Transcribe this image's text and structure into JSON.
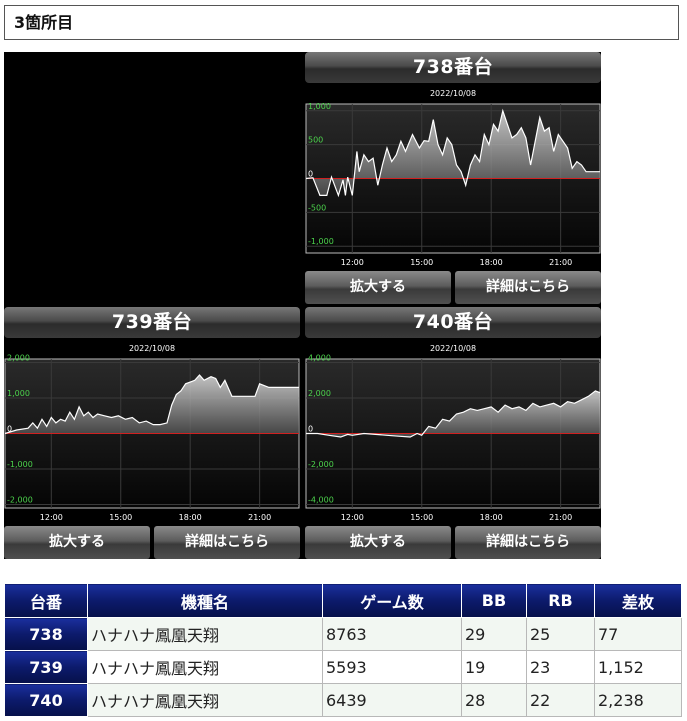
{
  "heading": "3箇所目",
  "machines": [
    {
      "title": "738番台",
      "date": "2022/10/08",
      "zoom_label": "拡大する",
      "detail_label": "詳細はこちら",
      "chart_data": {
        "type": "line",
        "y_ticks": [
          "1,000",
          "500",
          "0",
          "-500",
          "-1,000"
        ],
        "ylim": [
          -1100,
          1100
        ],
        "x_ticks": [
          "12:00",
          "15:00",
          "18:00",
          "21:00"
        ],
        "x_tick_hours": [
          12,
          15,
          18,
          21
        ],
        "xlim": [
          10.0,
          22.7
        ],
        "x": [
          10.0,
          10.3,
          10.6,
          10.9,
          11.1,
          11.4,
          11.6,
          11.7,
          11.8,
          12.0,
          12.2,
          12.3,
          12.5,
          12.7,
          12.9,
          13.1,
          13.3,
          13.5,
          13.7,
          13.9,
          14.1,
          14.3,
          14.6,
          14.9,
          15.1,
          15.3,
          15.5,
          15.7,
          15.9,
          16.1,
          16.3,
          16.5,
          16.7,
          16.9,
          17.1,
          17.3,
          17.5,
          17.7,
          17.9,
          18.1,
          18.3,
          18.5,
          18.7,
          18.9,
          19.1,
          19.3,
          19.5,
          19.7,
          19.9,
          20.1,
          20.3,
          20.5,
          20.7,
          20.9,
          21.1,
          21.3,
          21.5,
          21.7,
          21.9,
          22.1,
          22.3,
          22.7
        ],
        "values": [
          0,
          10,
          -250,
          -250,
          20,
          -250,
          -20,
          -250,
          20,
          -250,
          400,
          100,
          350,
          250,
          300,
          -100,
          200,
          450,
          250,
          350,
          550,
          400,
          650,
          450,
          560,
          550,
          870,
          500,
          350,
          600,
          500,
          200,
          100,
          -100,
          200,
          350,
          250,
          650,
          500,
          800,
          700,
          1000,
          800,
          600,
          650,
          750,
          600,
          200,
          550,
          900,
          700,
          750,
          400,
          650,
          550,
          450,
          150,
          250,
          200,
          100,
          100,
          100
        ],
        "zero_line": 0
      }
    },
    {
      "title": "739番台",
      "date": "2022/10/08",
      "zoom_label": "拡大する",
      "detail_label": "詳細はこちら",
      "chart_data": {
        "type": "line",
        "y_ticks": [
          "2,000",
          "1,000",
          "0",
          "-1,000",
          "-2,000"
        ],
        "ylim": [
          -2100,
          2100
        ],
        "x_ticks": [
          "12:00",
          "15:00",
          "18:00",
          "21:00"
        ],
        "x_tick_hours": [
          12,
          15,
          18,
          21
        ],
        "xlim": [
          10.0,
          22.7
        ],
        "x": [
          10.0,
          10.5,
          11.0,
          11.2,
          11.4,
          11.6,
          11.8,
          12.0,
          12.2,
          12.4,
          12.6,
          12.8,
          13.0,
          13.2,
          13.4,
          13.6,
          13.8,
          14.0,
          14.3,
          14.6,
          14.9,
          15.2,
          15.5,
          15.8,
          16.1,
          16.4,
          16.7,
          17.0,
          17.2,
          17.4,
          17.6,
          17.8,
          18.0,
          18.2,
          18.4,
          18.6,
          18.9,
          19.1,
          19.3,
          19.5,
          19.8,
          20.1,
          20.4,
          20.6,
          20.8,
          21.0,
          21.4,
          21.8,
          22.2,
          22.7
        ],
        "values": [
          0,
          100,
          150,
          300,
          150,
          400,
          200,
          450,
          300,
          400,
          350,
          600,
          400,
          750,
          500,
          600,
          450,
          550,
          500,
          450,
          500,
          400,
          450,
          300,
          350,
          250,
          250,
          300,
          800,
          1100,
          1200,
          1400,
          1450,
          1500,
          1650,
          1500,
          1600,
          1550,
          1300,
          1500,
          1050,
          1050,
          1050,
          1050,
          1050,
          1400,
          1300,
          1300,
          1300,
          1300
        ],
        "zero_line": 0
      }
    },
    {
      "title": "740番台",
      "date": "2022/10/08",
      "zoom_label": "拡大する",
      "detail_label": "詳細はこちら",
      "chart_data": {
        "type": "line",
        "y_ticks": [
          "4,000",
          "2,000",
          "0",
          "-2,000",
          "-4,000"
        ],
        "ylim": [
          -4200,
          4200
        ],
        "x_ticks": [
          "12:00",
          "15:00",
          "18:00",
          "21:00"
        ],
        "x_tick_hours": [
          12,
          15,
          18,
          21
        ],
        "xlim": [
          10.0,
          22.7
        ],
        "x": [
          10.0,
          10.5,
          11.0,
          11.5,
          11.8,
          12.0,
          12.5,
          13.0,
          13.5,
          14.0,
          14.5,
          14.8,
          15.0,
          15.3,
          15.6,
          15.9,
          16.2,
          16.5,
          16.8,
          17.1,
          17.4,
          17.7,
          18.0,
          18.3,
          18.6,
          18.9,
          19.2,
          19.5,
          19.8,
          20.1,
          20.4,
          20.7,
          21.0,
          21.3,
          21.6,
          21.9,
          22.2,
          22.5,
          22.7
        ],
        "values": [
          0,
          0,
          -100,
          -200,
          -50,
          -100,
          0,
          -50,
          -100,
          -150,
          -200,
          0,
          -100,
          400,
          300,
          800,
          700,
          1100,
          1200,
          1400,
          1300,
          1400,
          1500,
          1200,
          1600,
          1400,
          1500,
          1300,
          1700,
          1500,
          1600,
          1700,
          1500,
          1800,
          1700,
          1900,
          2100,
          2400,
          2300
        ],
        "zero_line": 0
      }
    }
  ],
  "table": {
    "headers": [
      "台番",
      "機種名",
      "ゲーム数",
      "BB",
      "RB",
      "差枚"
    ],
    "rows": [
      {
        "no": "738",
        "name": "ハナハナ鳳凰天翔",
        "games": "8763",
        "bb": "29",
        "rb": "25",
        "diff": "77"
      },
      {
        "no": "739",
        "name": "ハナハナ鳳凰天翔",
        "games": "5593",
        "bb": "19",
        "rb": "23",
        "diff": "1,152"
      },
      {
        "no": "740",
        "name": "ハナハナ鳳凰天翔",
        "games": "6439",
        "bb": "28",
        "rb": "22",
        "diff": "2,238"
      }
    ]
  },
  "colors": {
    "header_gradient_top": "#1a2f9e",
    "header_gradient_bottom": "#06104a",
    "tick_label_green": "#4cd24c",
    "zero_line_red": "#d02020",
    "series_line": "#ffffff"
  }
}
